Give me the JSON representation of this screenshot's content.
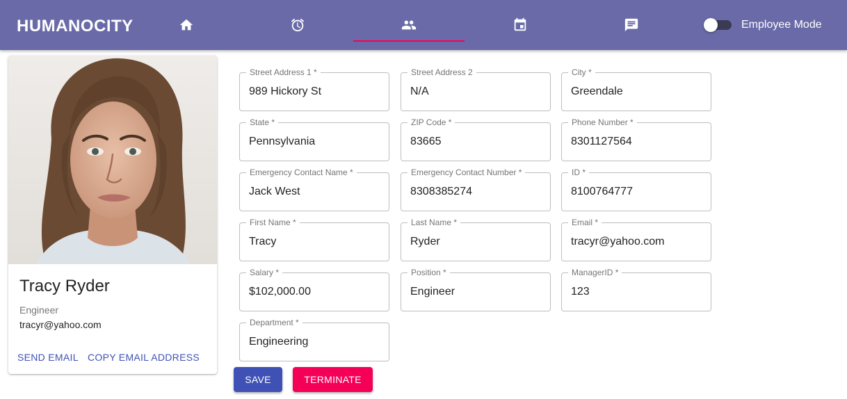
{
  "app": {
    "brand": "HUMANOCITY"
  },
  "nav": {
    "tabs": [
      {
        "icon": "home-icon"
      },
      {
        "icon": "alarm-icon"
      },
      {
        "icon": "people-icon",
        "active": true
      },
      {
        "icon": "calendar-icon"
      },
      {
        "icon": "chat-icon"
      }
    ],
    "employee_mode_label": "Employee Mode",
    "employee_mode_on": false
  },
  "profile": {
    "name": "Tracy Ryder",
    "position": "Engineer",
    "email": "tracyr@yahoo.com",
    "send_email_label": "SEND EMAIL",
    "copy_email_label": "COPY EMAIL ADDRESS"
  },
  "form": {
    "street1": {
      "label": "Street Address 1 *",
      "value": "989 Hickory St"
    },
    "street2": {
      "label": "Street Address 2",
      "value": "N/A"
    },
    "city": {
      "label": "City *",
      "value": "Greendale"
    },
    "state": {
      "label": "State *",
      "value": "Pennsylvania"
    },
    "zip": {
      "label": "ZIP Code *",
      "value": "83665"
    },
    "phone": {
      "label": "Phone Number *",
      "value": "8301127564"
    },
    "emergency_name": {
      "label": "Emergency Contact Name *",
      "value": "Jack West"
    },
    "emergency_number": {
      "label": "Emergency Contact Number *",
      "value": "8308385274"
    },
    "id": {
      "label": "ID *",
      "value": "8100764777"
    },
    "first_name": {
      "label": "First Name *",
      "value": "Tracy"
    },
    "last_name": {
      "label": "Last Name *",
      "value": "Ryder"
    },
    "email": {
      "label": "Email *",
      "value": "tracyr@yahoo.com"
    },
    "salary": {
      "label": "Salary *",
      "value": "$102,000.00"
    },
    "position": {
      "label": "Position *",
      "value": "Engineer"
    },
    "manager_id": {
      "label": "ManagerID *",
      "value": "123"
    },
    "department": {
      "label": "Department *",
      "value": "Engineering"
    }
  },
  "actions": {
    "save_label": "SAVE",
    "terminate_label": "TERMINATE"
  },
  "colors": {
    "appbar": "#6a6aa8",
    "primary": "#3f51b5",
    "secondary": "#f50057"
  }
}
